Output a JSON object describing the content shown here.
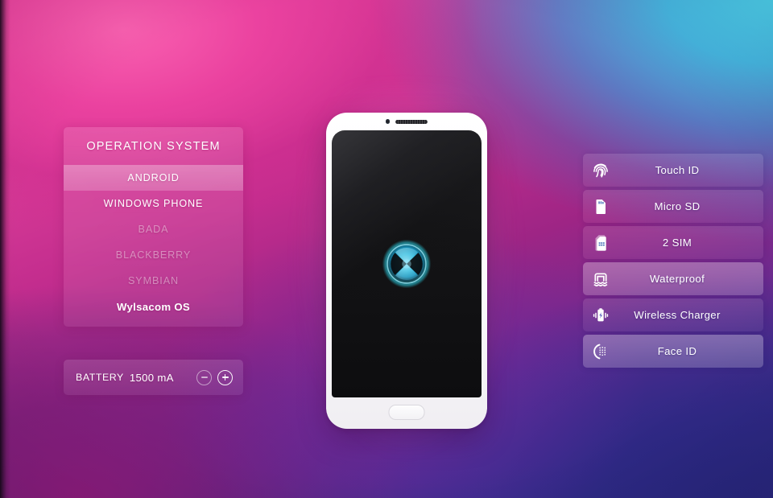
{
  "background": {
    "top_left_color": "#f453a8",
    "top_right_color": "#4ccee a",
    "bottom_left_color": "#8c1a7a",
    "bottom_right_color": "#28267e",
    "accent_cyan": "#3fd2e8"
  },
  "os_panel": {
    "title": "OPERATION SYSTEM",
    "items": [
      {
        "label": "ANDROID",
        "state": "selected"
      },
      {
        "label": "WINDOWS PHONE",
        "state": "normal"
      },
      {
        "label": "BADA",
        "state": "disabled"
      },
      {
        "label": "BLACKBERRY",
        "state": "disabled"
      },
      {
        "label": "SYMBIAN",
        "state": "disabled"
      },
      {
        "label": "Wylsacom OS",
        "state": "emphasis"
      }
    ]
  },
  "battery": {
    "label": "BATTERY",
    "value": "1500 mA",
    "decrease_icon": "minus-circle-icon",
    "increase_icon": "plus-circle-icon"
  },
  "phone": {
    "camera_icon": "front-camera-icon",
    "speaker_icon": "earpiece-speaker-icon",
    "logo_icon": "wylsacom-orb-logo-icon",
    "home_button_icon": "home-button-icon",
    "logo_colors": {
      "outer": "#2ee0f5",
      "inner": "#8ef0ff",
      "core": "#0b8fb8"
    }
  },
  "features": [
    {
      "label": "Touch ID",
      "icon": "fingerprint-icon",
      "state": "normal"
    },
    {
      "label": "Micro SD",
      "icon": "sd-card-icon",
      "state": "normal"
    },
    {
      "label": "2 SIM",
      "icon": "sim-card-icon",
      "state": "normal"
    },
    {
      "label": "Waterproof",
      "icon": "waterproof-icon",
      "state": "selected"
    },
    {
      "label": "Wireless Charger",
      "icon": "wireless-charger-icon",
      "state": "normal"
    },
    {
      "label": "Face ID",
      "icon": "face-id-icon",
      "state": "selected"
    }
  ]
}
